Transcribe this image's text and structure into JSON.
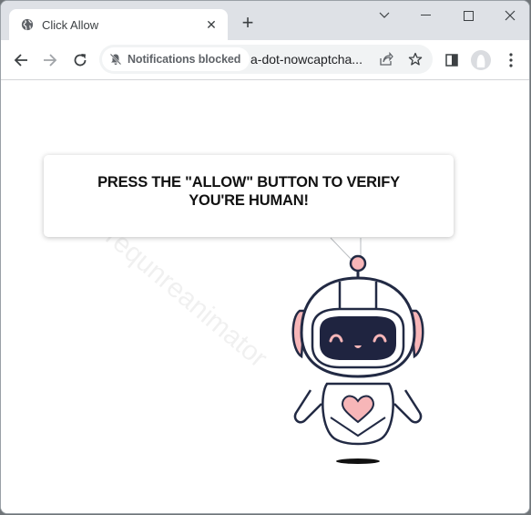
{
  "browser": {
    "tab": {
      "title": "Click Allow",
      "icon": "globe-icon",
      "close_icon": "close-icon"
    },
    "new_tab_icon": "plus-icon",
    "window_controls": {
      "tab_search": "chevron-down-icon",
      "minimize": "minimize-icon",
      "maximize": "maximize-icon",
      "close": "close-icon"
    },
    "toolbar": {
      "back": "back-arrow-icon",
      "forward": "forward-arrow-icon",
      "reload": "reload-icon",
      "notification_chip": {
        "label": "Notifications blocked",
        "icon": "bell-slash-icon"
      },
      "url": "a-dot-nowcaptcha...",
      "share": "share-icon",
      "bookmark": "star-icon",
      "side_panel": "side-panel-icon",
      "profile": "avatar-icon",
      "menu": "kebab-menu-icon"
    }
  },
  "page": {
    "bubble_text": "PRESS THE \"ALLOW\" BUTTON TO VERIFY YOU'RE HUMAN!",
    "watermark": "requnreanimator",
    "colors": {
      "robot_outline": "#222a44",
      "robot_accent": "#f7b6b8",
      "visor": "#1f2440"
    }
  }
}
